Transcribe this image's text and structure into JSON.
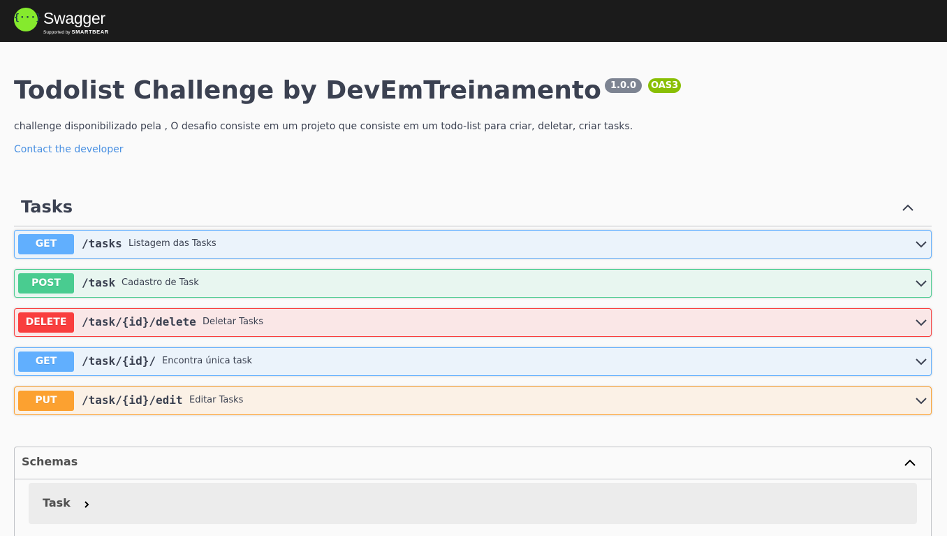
{
  "topbar": {
    "logo_symbol": "{···}",
    "logo_word": "Swagger",
    "logo_sub_prefix": "Supported by",
    "logo_sub_brand": "SMARTBEAR"
  },
  "info": {
    "title": "Todolist Challenge by DevEmTreinamento",
    "version": "1.0.0",
    "oas": "OAS3",
    "description": "challenge disponibilizado pela , O desafio consiste em um projeto que consiste em um todo-list para criar, deletar, criar tasks.",
    "contact": "Contact the developer"
  },
  "tag": {
    "name": "Tasks"
  },
  "operations": [
    {
      "method": "GET",
      "path": "/tasks",
      "summary": "Listagem das Tasks"
    },
    {
      "method": "POST",
      "path": "/task",
      "summary": "Cadastro de Task"
    },
    {
      "method": "DELETE",
      "path": "/task/{id}/delete",
      "summary": "Deletar Tasks"
    },
    {
      "method": "GET",
      "path": "/task/{id}/",
      "summary": "Encontra única task"
    },
    {
      "method": "PUT",
      "path": "/task/{id}/edit",
      "summary": "Editar Tasks"
    }
  ],
  "schemas": {
    "title": "Schemas",
    "models": [
      {
        "name": "Task"
      }
    ]
  },
  "colors": {
    "get": "#61affe",
    "post": "#49cc90",
    "delete": "#f93e3e",
    "put": "#fca130",
    "topbar": "#1b1b1b",
    "logo_green": "#85ea2d",
    "link": "#4990e2"
  },
  "icons": {
    "expand": "chevron-down-icon",
    "collapse": "chevron-up-icon",
    "model_expand": "chevron-right-icon"
  }
}
